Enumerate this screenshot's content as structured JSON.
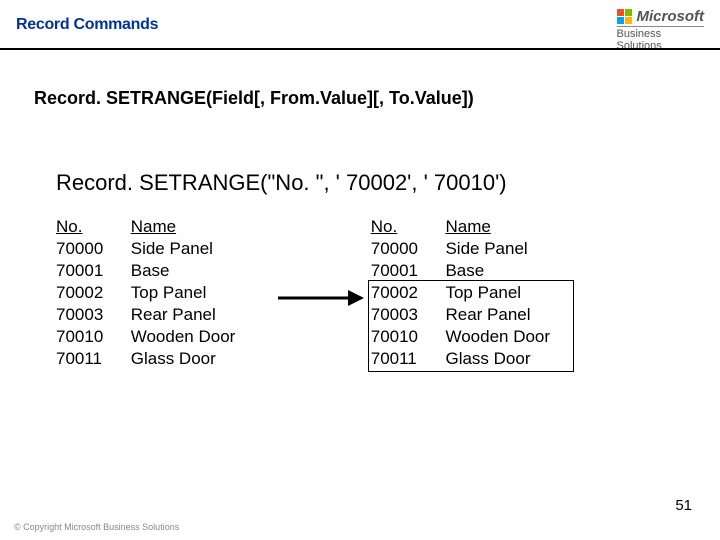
{
  "header": {
    "title": "Record Commands",
    "logo_brand": "Microsoft",
    "logo_line1": "Business",
    "logo_line2": "Solutions"
  },
  "syntax": "Record. SETRANGE(Field[, From.Value][, To.Value])",
  "example": "Record. SETRANGE(\"No. \", ' 70002', ' 70010')",
  "left_table": {
    "header_no": "No.",
    "header_name": "Name",
    "rows": [
      {
        "no": "70000",
        "name": "Side Panel"
      },
      {
        "no": "70001",
        "name": "Base"
      },
      {
        "no": "70002",
        "name": "Top Panel"
      },
      {
        "no": "70003",
        "name": "Rear Panel"
      },
      {
        "no": "70010",
        "name": "Wooden Door"
      },
      {
        "no": "70011",
        "name": "Glass Door"
      }
    ]
  },
  "right_table": {
    "header_no": "No.",
    "header_name": "Name",
    "rows": [
      {
        "no": "70000",
        "name": "Side Panel"
      },
      {
        "no": "70001",
        "name": "Base"
      },
      {
        "no": "70002",
        "name": "Top Panel"
      },
      {
        "no": "70003",
        "name": "Rear Panel"
      },
      {
        "no": "70010",
        "name": "Wooden Door"
      },
      {
        "no": "70011",
        "name": "Glass Door"
      }
    ]
  },
  "page_number": "51",
  "copyright": "© Copyright Microsoft Business Solutions"
}
